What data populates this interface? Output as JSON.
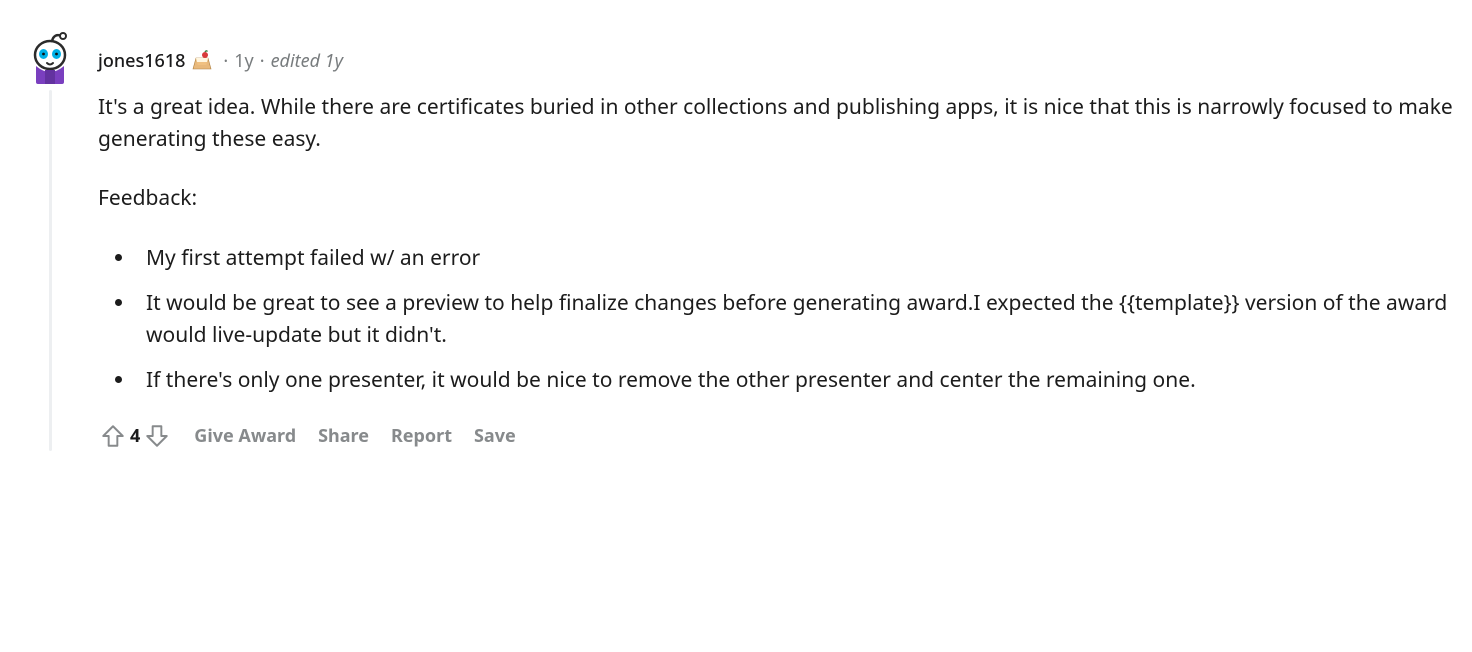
{
  "comment": {
    "author": "jones1618",
    "posted": "1y",
    "edited_label": "edited 1y",
    "body": {
      "p1": "It's a great idea. While there are certificates buried in other collections and publishing apps, it is nice that this is narrowly focused to make generating these easy.",
      "p2": "Feedback:",
      "li1": "My first attempt failed w/ an error",
      "li2": "It would be great to see a preview to help finalize changes before generating award.I expected the {{template}} version of the award would live-update but it didn't.",
      "li3": "If there's only one presenter, it would be nice to remove the other presenter and center the remaining one."
    },
    "score": "4",
    "actions": {
      "award": "Give Award",
      "share": "Share",
      "report": "Report",
      "save": "Save"
    }
  }
}
